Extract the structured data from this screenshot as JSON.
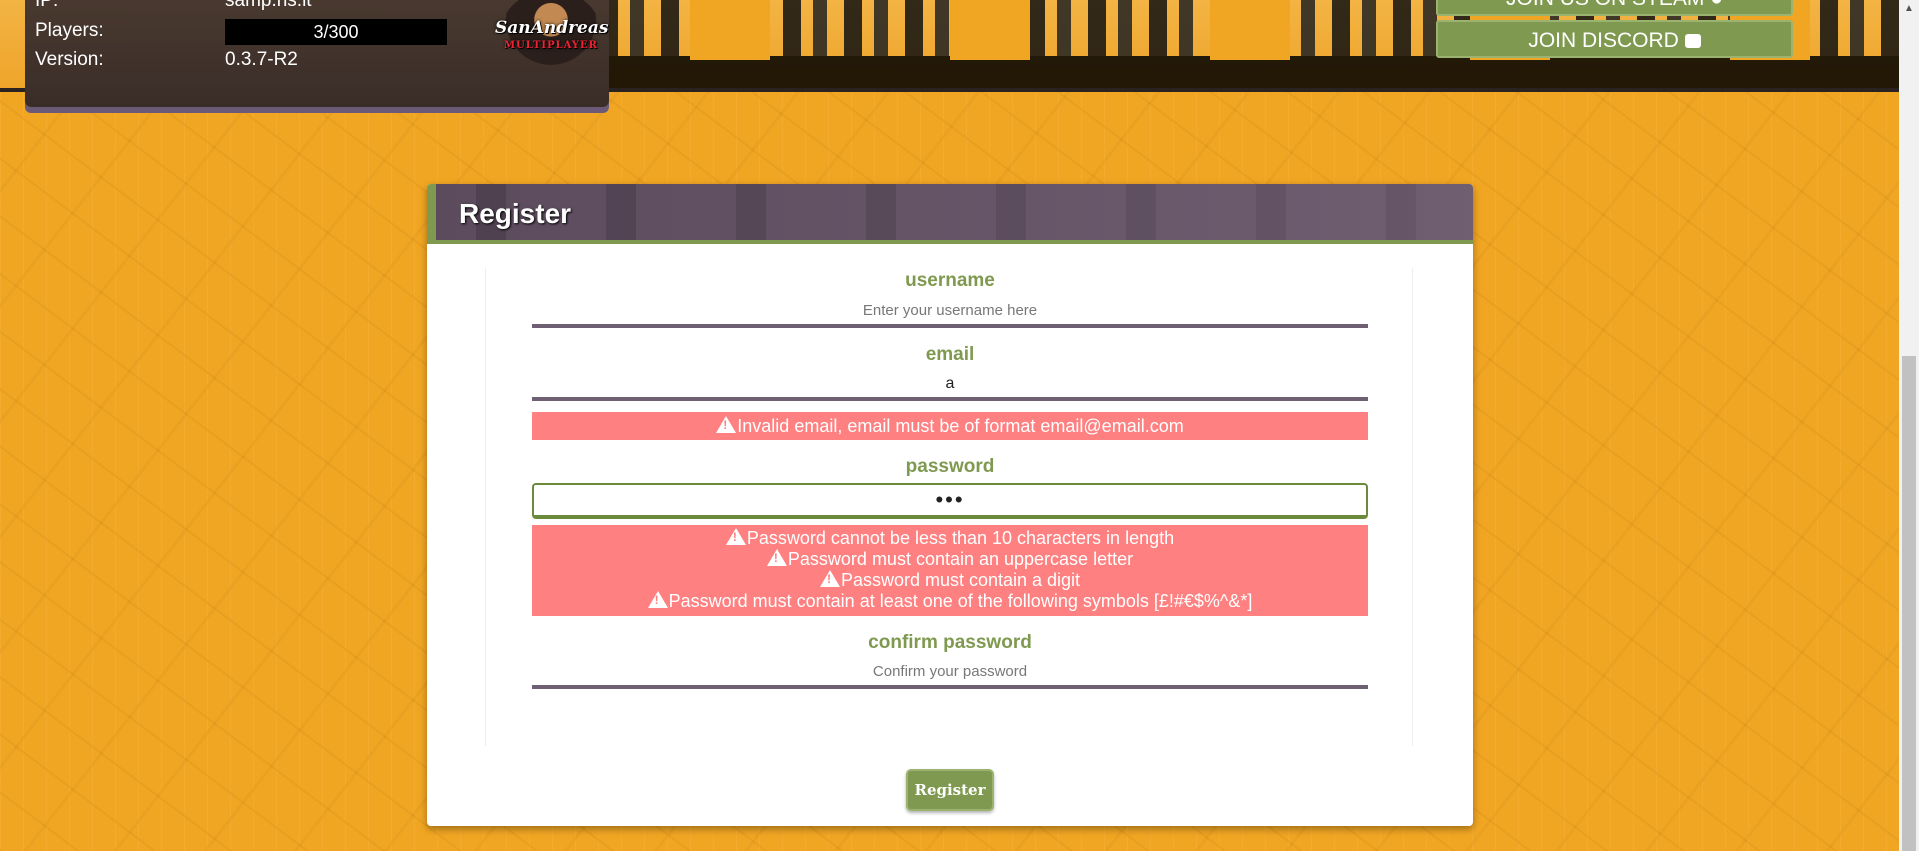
{
  "server": {
    "ip_label": "IP:",
    "ip_value": "samp.ns.lt",
    "players_label": "Players:",
    "players_value": "3/300",
    "version_label": "Version:",
    "version_value": "0.3.7-R2"
  },
  "logo": {
    "text": "SanAndreas",
    "sub": "MULTIPLAYER"
  },
  "header_buttons": {
    "steam": "JOIN US ON STEAM",
    "discord": "JOIN DISCORD"
  },
  "register": {
    "title": "Register",
    "username": {
      "label": "username",
      "placeholder": "Enter your username here",
      "value": ""
    },
    "email": {
      "label": "email",
      "value": "a"
    },
    "email_error": "Invalid email, email must be of format email@email.com",
    "password": {
      "label": "password",
      "value": "•••"
    },
    "password_errors": [
      "Password cannot be less than 10 characters in length",
      "Password must contain an uppercase letter",
      "Password must contain a digit",
      "Password must contain at least one of the following symbols [£!#€$%^&*]"
    ],
    "confirm_password": {
      "label": "confirm password",
      "placeholder": "Confirm your password",
      "value": ""
    },
    "submit_label": "Register"
  },
  "colors": {
    "background": "#f1a623",
    "accent_green": "#7f9a50",
    "header_purple": "#5b4b5d",
    "error_red": "#fe8080"
  }
}
